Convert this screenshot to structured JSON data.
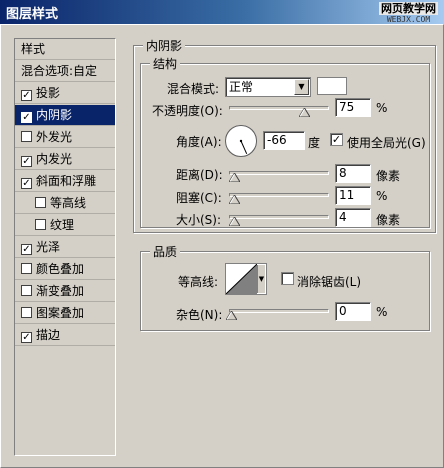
{
  "window": {
    "title": "图层样式"
  },
  "watermark": {
    "line1": "网页教学网",
    "line2": "WEBJX.COM"
  },
  "sidebar": {
    "header": "样式",
    "items": [
      {
        "label": "混合选项:自定",
        "checkbox": false,
        "checked": false,
        "indent": false,
        "selected": false
      },
      {
        "label": "投影",
        "checkbox": true,
        "checked": true,
        "indent": false,
        "selected": false
      },
      {
        "label": "内阴影",
        "checkbox": true,
        "checked": true,
        "indent": false,
        "selected": true
      },
      {
        "label": "外发光",
        "checkbox": true,
        "checked": false,
        "indent": false,
        "selected": false
      },
      {
        "label": "内发光",
        "checkbox": true,
        "checked": true,
        "indent": false,
        "selected": false
      },
      {
        "label": "斜面和浮雕",
        "checkbox": true,
        "checked": true,
        "indent": false,
        "selected": false
      },
      {
        "label": "等高线",
        "checkbox": true,
        "checked": false,
        "indent": true,
        "selected": false
      },
      {
        "label": "纹理",
        "checkbox": true,
        "checked": false,
        "indent": true,
        "selected": false
      },
      {
        "label": "光泽",
        "checkbox": true,
        "checked": true,
        "indent": false,
        "selected": false
      },
      {
        "label": "颜色叠加",
        "checkbox": true,
        "checked": false,
        "indent": false,
        "selected": false
      },
      {
        "label": "渐变叠加",
        "checkbox": true,
        "checked": false,
        "indent": false,
        "selected": false
      },
      {
        "label": "图案叠加",
        "checkbox": true,
        "checked": false,
        "indent": false,
        "selected": false
      },
      {
        "label": "描边",
        "checkbox": true,
        "checked": true,
        "indent": false,
        "selected": false
      }
    ]
  },
  "inner_shadow": {
    "title": "内阴影",
    "structure": {
      "title": "结构",
      "blend_mode_label": "混合模式:",
      "blend_mode_value": "正常",
      "shadow_color": "#ffffff",
      "opacity_label": "不透明度(O):",
      "opacity_value": "75",
      "opacity_unit": "%",
      "opacity_level": 0.75,
      "angle_label": "角度(A):",
      "angle_value": "-66",
      "angle_unit": "度",
      "global_light_label": "使用全局光(G)",
      "global_light_checked": true,
      "distance_label": "距离(D):",
      "distance_value": "8",
      "distance_unit": "像素",
      "choke_label": "阻塞(C):",
      "choke_value": "11",
      "choke_unit": "%",
      "size_label": "大小(S):",
      "size_value": "4",
      "size_unit": "像素"
    },
    "quality": {
      "title": "品质",
      "contour_label": "等高线:",
      "antialias_label": "消除锯齿(L)",
      "antialias_checked": false,
      "noise_label": "杂色(N):",
      "noise_value": "0",
      "noise_unit": "%"
    }
  },
  "colors": {
    "titlebar_start": "#0a246a",
    "selection": "#0a246a",
    "dialog_bg": "#d4d0c8"
  }
}
